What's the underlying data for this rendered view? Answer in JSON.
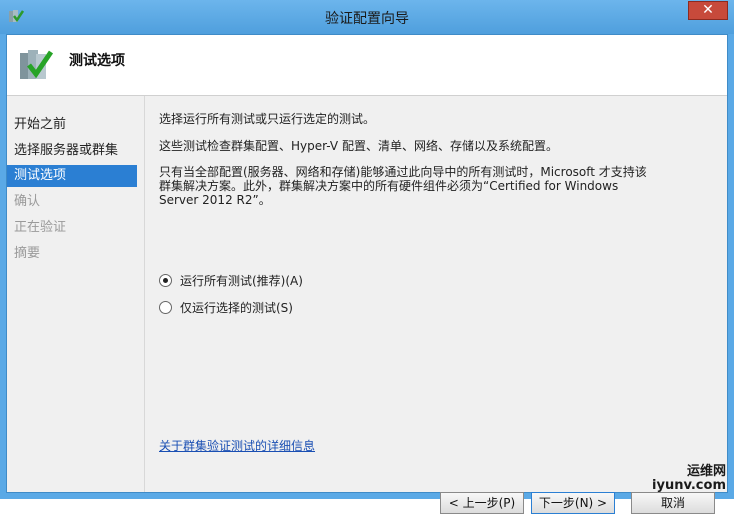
{
  "window": {
    "title": "验证配置向导"
  },
  "header": {
    "title": "测试选项",
    "icon": "cluster-validation-checkmark-icon"
  },
  "nav": {
    "items": [
      {
        "label": "开始之前",
        "state": "normal"
      },
      {
        "label": "选择服务器或群集",
        "state": "normal"
      },
      {
        "label": "测试选项",
        "state": "active"
      },
      {
        "label": "确认",
        "state": "disabled"
      },
      {
        "label": "正在验证",
        "state": "disabled"
      },
      {
        "label": "摘要",
        "state": "disabled"
      }
    ]
  },
  "main": {
    "intro": "选择运行所有测试或只运行选定的测试。",
    "desc": "这些测试检查群集配置、Hyper-V 配置、清单、网络、存储以及系统配置。",
    "note_line1": "只有当全部配置(服务器、网络和存储)能够通过此向导中的所有测试时，Microsoft 才支持该",
    "note_line2": "群集解决方案。此外，群集解决方案中的所有硬件组件必须为“Certified for Windows",
    "note_line3": "Server 2012 R2”。",
    "options": [
      {
        "label": "运行所有测试(推荐)(A)",
        "checked": true
      },
      {
        "label": "仅运行选择的测试(S)",
        "checked": false
      }
    ],
    "link": "关于群集验证测试的详细信息"
  },
  "buttons": {
    "prev": "< 上一步(P)",
    "next": "下一步(N) >",
    "cancel": "取消"
  },
  "watermark": {
    "line1": "运维网",
    "line2": "iyunv.com"
  },
  "colors": {
    "titlebar": "#5aa9e6",
    "active_nav": "#2b7fd3",
    "link": "#1a4fb3",
    "close": "#c74a3b"
  }
}
